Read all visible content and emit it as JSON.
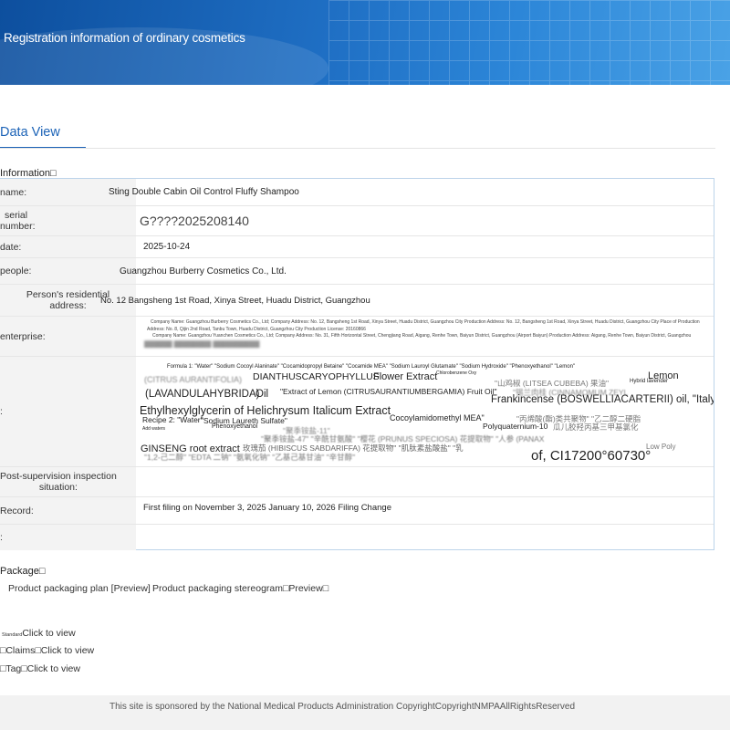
{
  "banner": {
    "title": "Registration information of ordinary cosmetics"
  },
  "tabs": {
    "active": "Data View"
  },
  "info_section": {
    "label": "Information"
  },
  "fields": {
    "name": {
      "label": "name:",
      "value": "Sting Double Cabin Oil Control Fluffy Shampoo"
    },
    "serial": {
      "label1": "serial",
      "label2": "number:",
      "value": "G????2025208140"
    },
    "date": {
      "label": "date:",
      "value": "2025-10-24"
    },
    "people": {
      "label": "people:",
      "value": "Guangzhou Burberry Cosmetics Co., Ltd."
    },
    "address": {
      "label1": "Person's residential",
      "label2": "address:",
      "value": "No. 12 Bangsheng 1st Road, Xinya Street, Huadu District, Guangzhou"
    },
    "enterprise": {
      "label": "enterprise:",
      "line1": "Company Name: Guangzhou Burberry Cosmetics Co., Ltd; Company Address: No. 12, Bangsheng 1st Road, Xinya Street, Huadu District, Guangzhou City Production Address: No. 12, Bangsheng 1st Road, Xinya Street, Huadu District, Guangzhou City Place of Production",
      "line2": "Address: No. 8, Qijin 2nd Road, Tanbu Town, Huadu District, Guangzhou City Production License: 20160866",
      "line3": "Company Name: Guangzhou Yuanchen Cosmetics Co., Ltd; Company Address: No. 31, Fifth Horizontal Street, Chengjiang Road, Aigang, Renhe Town, Baiyun District, Guangzhou (Airport Baiyun) Production Address: Aigang, Renhe Town, Baiyun District, Guangzhou"
    },
    "formula": {
      "label": ":",
      "f1": "Formula 1: \"Water\" \"Sodium Cocoyl Alaninate\" \"Cocamidopropyl Betaine\" \"Cocamide MEA\" \"Sodium Lauroyl Glutamate\" \"Sodium Hydroxide\" \"Phenoxyethanol\" \"Lemon\"",
      "s1": "(CITRUS AURANTIFOLIA)",
      "s2": "DIANTHUSCARYOPHYLLUS",
      "s3": "Flower Extract",
      "s4": "Chlorobenzene Oxy",
      "s5": "\"山鸡椒 (LITSEA CUBEBA) 果油\"",
      "s6": "Hybrid lavender",
      "s7": "Lemon",
      "s8": "(LAVANDULAHYBRIDA)",
      "s9": "Oil",
      "s10": "\"Extract of Lemon (CITRUSAURANTIUMBERGAMIA) Fruit Oil\"",
      "s11": "\"锡兰肉桂 (CINNAMOMUM ZEYL",
      "s12": "Frankincense (BOSWELLIACARTERII) oil, \"Italy",
      "s13": "Ethylhexylglycerin of Helichrysum Italicum Extract",
      "s14": "Recipe 2: \"Water\"",
      "s15": "\"Sodium Laureth Sulfate\"",
      "s16": "Add waters",
      "s17": "Phenoxyethanol",
      "s18": "Cocoylamidomethyl MEA\"",
      "s19": "\"丙烯酸(酯)类共聚物\" \"乙二醇二硬脂",
      "s20": "Polyquaternium-10",
      "s21": "瓜儿胶羟丙基三甲基氯化",
      "s22": "\"聚季铵盐-11\"",
      "s23": "\"聚季铵盐-47\" \"辛酰甘氨酸\" \"樱花 (PRUNUS SPECIOSA) 花提取物\" \"人参 (PANAX",
      "s24": "GINSENG root extract",
      "s25": "玫瑰茄 (HIBISCUS SABDARIFFA) 花提取物\" \"肌肽素盐酸盐\" \"乳",
      "s26": "Low Poly",
      "s27": "\"1,2-己二醇\" \"EDTA 二钠\" \"氨氧化钠\" \"乙基己基甘油\" \"辛甘醇\"",
      "s28": "of, CI17200°60730°"
    },
    "post": {
      "label1": "Post-supervision inspection",
      "label2": "situation:",
      "value": ""
    },
    "record": {
      "label": "Record:",
      "value1": "First filing on November 3, 2025",
      "value2": "January 10, 2026 Filing Change"
    },
    "empty": {
      "label": ":"
    }
  },
  "package": {
    "label": "Package",
    "plan": "Product packaging plan [Preview]",
    "stereogram": "Product packaging stereogram",
    "preview": "Preview"
  },
  "links": {
    "standard_label": "Standard",
    "standard": "Click to view",
    "claims_label": "Claims",
    "claims": "Click to view",
    "tag_label": "Tag",
    "tag": "Click to view"
  },
  "footer": {
    "text": "This site is sponsored by the National Medical Products Administration CopyrightCopyrightNMPAAllRightsReserved"
  }
}
